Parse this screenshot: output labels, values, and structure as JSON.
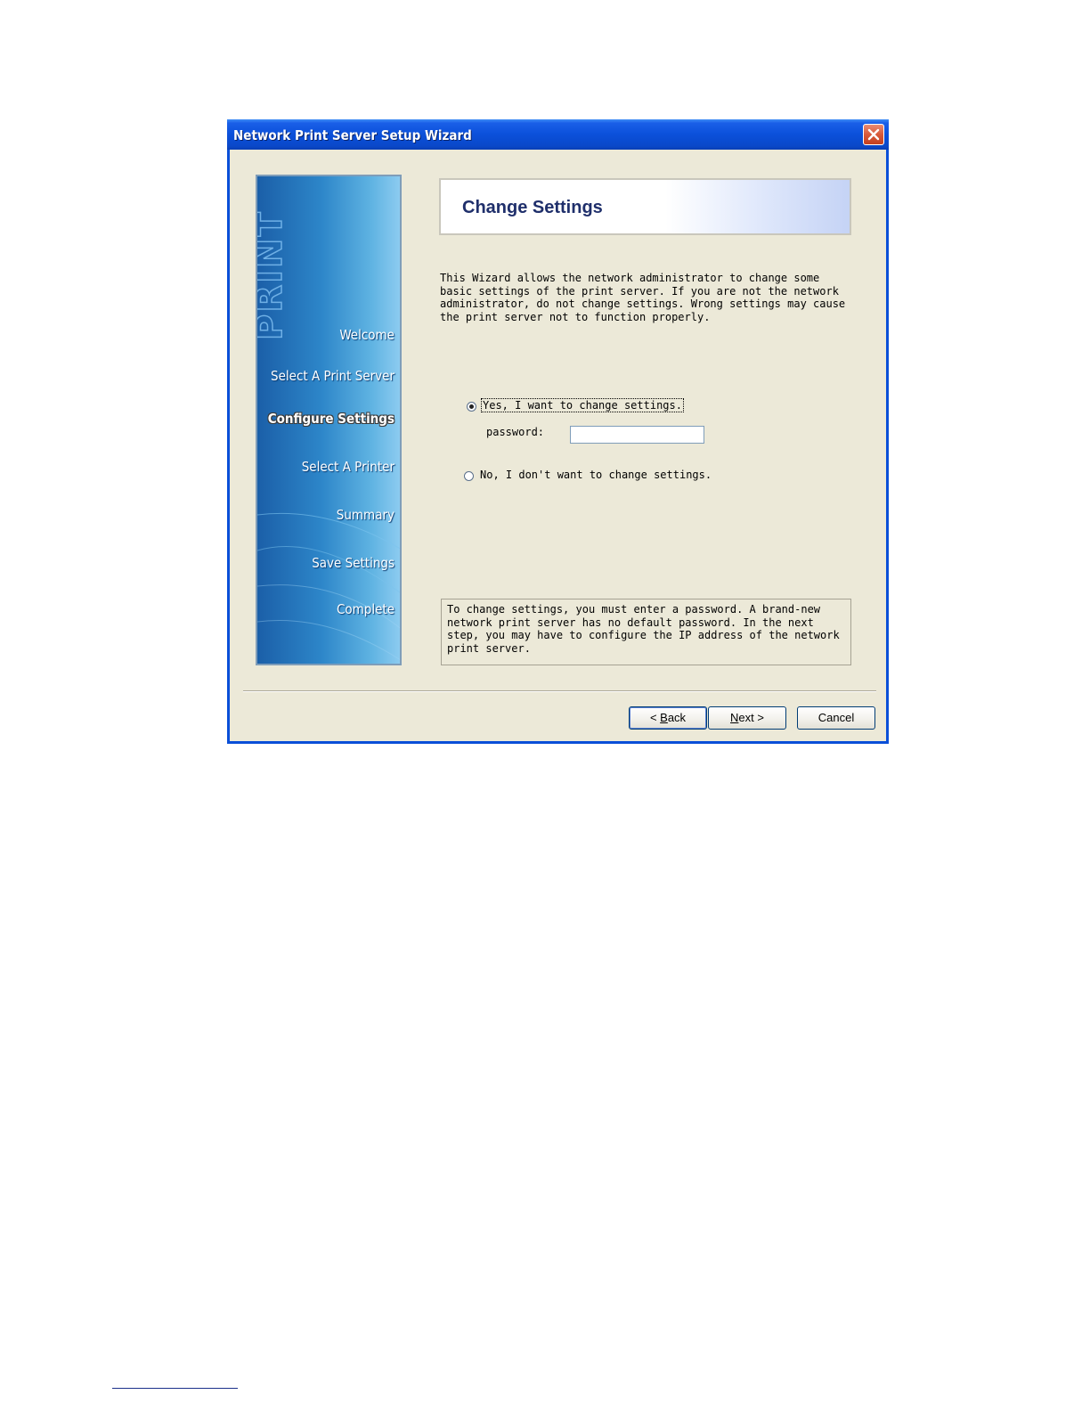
{
  "window": {
    "title": "Network Print Server Setup Wizard"
  },
  "sidebar": {
    "steps": [
      {
        "label": "Welcome",
        "active": false
      },
      {
        "label": "Select A Print Server",
        "active": false
      },
      {
        "label": "Configure Settings",
        "active": true
      },
      {
        "label": "Select  A  Printer",
        "active": false
      },
      {
        "label": "Summary",
        "active": false
      },
      {
        "label": "Save Settings",
        "active": false
      },
      {
        "label": "Complete",
        "active": false
      }
    ],
    "decoration_text": "PRINT"
  },
  "header": {
    "title": "Change Settings"
  },
  "intro_text": "This Wizard allows the network administrator to change some\nbasic settings of the print server. If you are not the network\nadministrator, do not change settings. Wrong settings may cause\nthe print server not to function properly.",
  "options": {
    "yes_label": "Yes, I want to change settings.",
    "no_label": "No, I don't want to change settings.",
    "selected": "yes"
  },
  "password": {
    "label": "password:",
    "value": ""
  },
  "info_text": "To change settings, you must enter a password. A brand-new\nnetwork print server has no default password. In the next\nstep, you may have to configure the IP address of the network\nprint server.",
  "buttons": {
    "back_prefix": "< ",
    "back_accel": "B",
    "back_rest": "ack",
    "next_accel": "N",
    "next_rest": "ext >",
    "cancel": "Cancel"
  },
  "colors": {
    "titlebar": "#0b50da",
    "sidebar": "#2d86c9",
    "dialog_bg": "#ece9d8",
    "header_title": "#1f2f6b"
  }
}
